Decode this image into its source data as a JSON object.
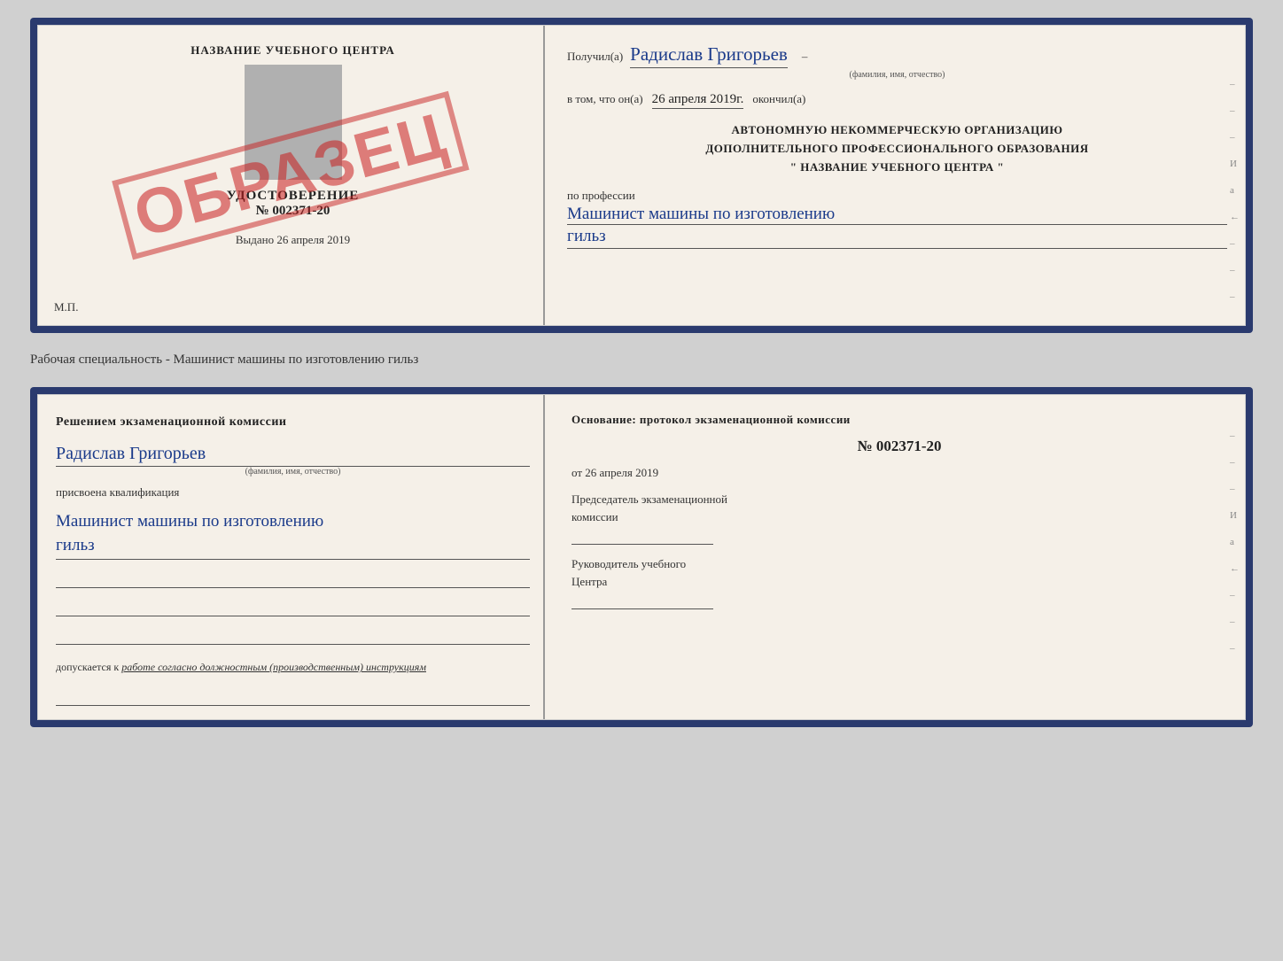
{
  "top_document": {
    "left": {
      "center_title": "НАЗВАНИЕ УЧЕБНОГО ЦЕНТРА",
      "gray_box": true,
      "udostoverenie_label": "УДОСТОВЕРЕНИЕ",
      "udostoverenie_number": "№ 002371-20",
      "vydano": "Выдано",
      "vydano_date": "26 апреля 2019",
      "mp_label": "М.П.",
      "stamp": "ОБРАЗЕЦ"
    },
    "right": {
      "poluchil_prefix": "Получил(а)",
      "recipient_name": "Радислав Григорьев",
      "recipient_sublabel": "(фамилия, имя, отчество)",
      "vtom_prefix": "в том, что он(а)",
      "vtom_date": "26 апреля 2019г.",
      "okончил": "окончил(а)",
      "org_line1": "АВТОНОМНУЮ НЕКОММЕРЧЕСКУЮ ОРГАНИЗАЦИЮ",
      "org_line2": "ДОПОЛНИТЕЛЬНОГО ПРОФЕССИОНАЛЬНОГО ОБРАЗОВАНИЯ",
      "org_line3": "\"  НАЗВАНИЕ УЧЕБНОГО ЦЕНТРА  \"",
      "profession_label": "по профессии",
      "profession_handwritten1": "Машинист машины по изготовлению",
      "profession_handwritten2": "гильз",
      "side_marks": [
        "-",
        "-",
        "-",
        "И",
        "а",
        "←",
        "-",
        "-",
        "-"
      ]
    }
  },
  "separator": {
    "text": "Рабочая специальность - Машинист машины по изготовлению гильз"
  },
  "bottom_document": {
    "left": {
      "komissia_title": "Решением  экзаменационной  комиссии",
      "name_handwritten": "Радислав Григорьев",
      "name_sublabel": "(фамилия, имя, отчество)",
      "prisvoena_text": "присвоена квалификация",
      "qualification_line1": "Машинист  машины  по  изготовлению",
      "qualification_line2": "гильз",
      "dopuskaetsya_prefix": "допускается к",
      "dopuskaetsya_text": "работе согласно должностным (производственным) инструкциям"
    },
    "right": {
      "osnovanie_title": "Основание: протокол экзаменационной  комиссии",
      "protocol_number": "№  002371-20",
      "date_prefix": "от",
      "date_value": "26 апреля 2019",
      "chairman_line1": "Председатель экзаменационной",
      "chairman_line2": "комиссии",
      "rukovoditel_line1": "Руководитель учебного",
      "rukovoditel_line2": "Центра",
      "side_marks": [
        "-",
        "-",
        "-",
        "И",
        "а",
        "←",
        "-",
        "-",
        "-"
      ]
    }
  }
}
